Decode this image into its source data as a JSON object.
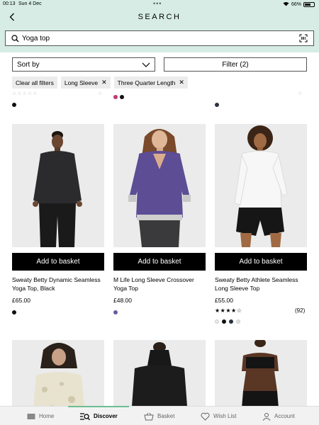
{
  "status_bar": {
    "time": "00:13",
    "date": "Sun 4 Dec",
    "battery": "66%"
  },
  "header": {
    "title": "SEARCH"
  },
  "search": {
    "value": "Yoga top"
  },
  "sort": {
    "label": "Sort by"
  },
  "filter": {
    "label": "Filter (2)"
  },
  "chips": [
    {
      "label": "Clear all filters"
    },
    {
      "label": "Long Sleeve"
    },
    {
      "label": "Three Quarter Length"
    }
  ],
  "products": [
    {
      "button_label": "Add to basket",
      "name": "Sweaty Betty Dynamic Seamless Yoga Top, Black",
      "price": "£65.00",
      "swatches": [
        "#111111"
      ]
    },
    {
      "button_label": "Add to basket",
      "name": "M Life Long Sleeve Crossover Yoga Top",
      "price": "£48.00",
      "swatches": [
        "#6b5aa0"
      ]
    },
    {
      "button_label": "Add to basket",
      "name": "Sweaty Betty Athlete Seamless Long Sleeve Top",
      "price": "£55.00",
      "rating": 4,
      "rating_count": "(92)",
      "swatches": [
        "#e8e8e8",
        "#111111",
        "#2c3140",
        "#e0e0e0"
      ]
    }
  ],
  "nav": [
    {
      "label": "Home",
      "icon": "home-icon"
    },
    {
      "label": "Discover",
      "icon": "discover-icon",
      "active": true
    },
    {
      "label": "Basket",
      "icon": "basket-icon"
    },
    {
      "label": "Wish List",
      "icon": "heart-icon"
    },
    {
      "label": "Account",
      "icon": "account-icon"
    }
  ],
  "colors": {
    "header_bg": "#d6ece5",
    "nav_indicator": "#6cbf93"
  }
}
